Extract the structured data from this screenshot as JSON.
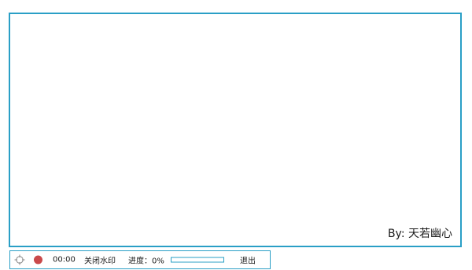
{
  "capture_area": {
    "watermark_text": "By: 天若幽心"
  },
  "toolbar": {
    "crosshair_icon": "crosshair-icon",
    "record_icon": "record-icon",
    "record_color": "#c9494b",
    "accent_color": "#2a9fc6",
    "timer": "00:00",
    "watermark_toggle_label": "关闭水印",
    "progress_label": "进度：0%",
    "progress_fraction": 0,
    "exit_label": "退出"
  }
}
